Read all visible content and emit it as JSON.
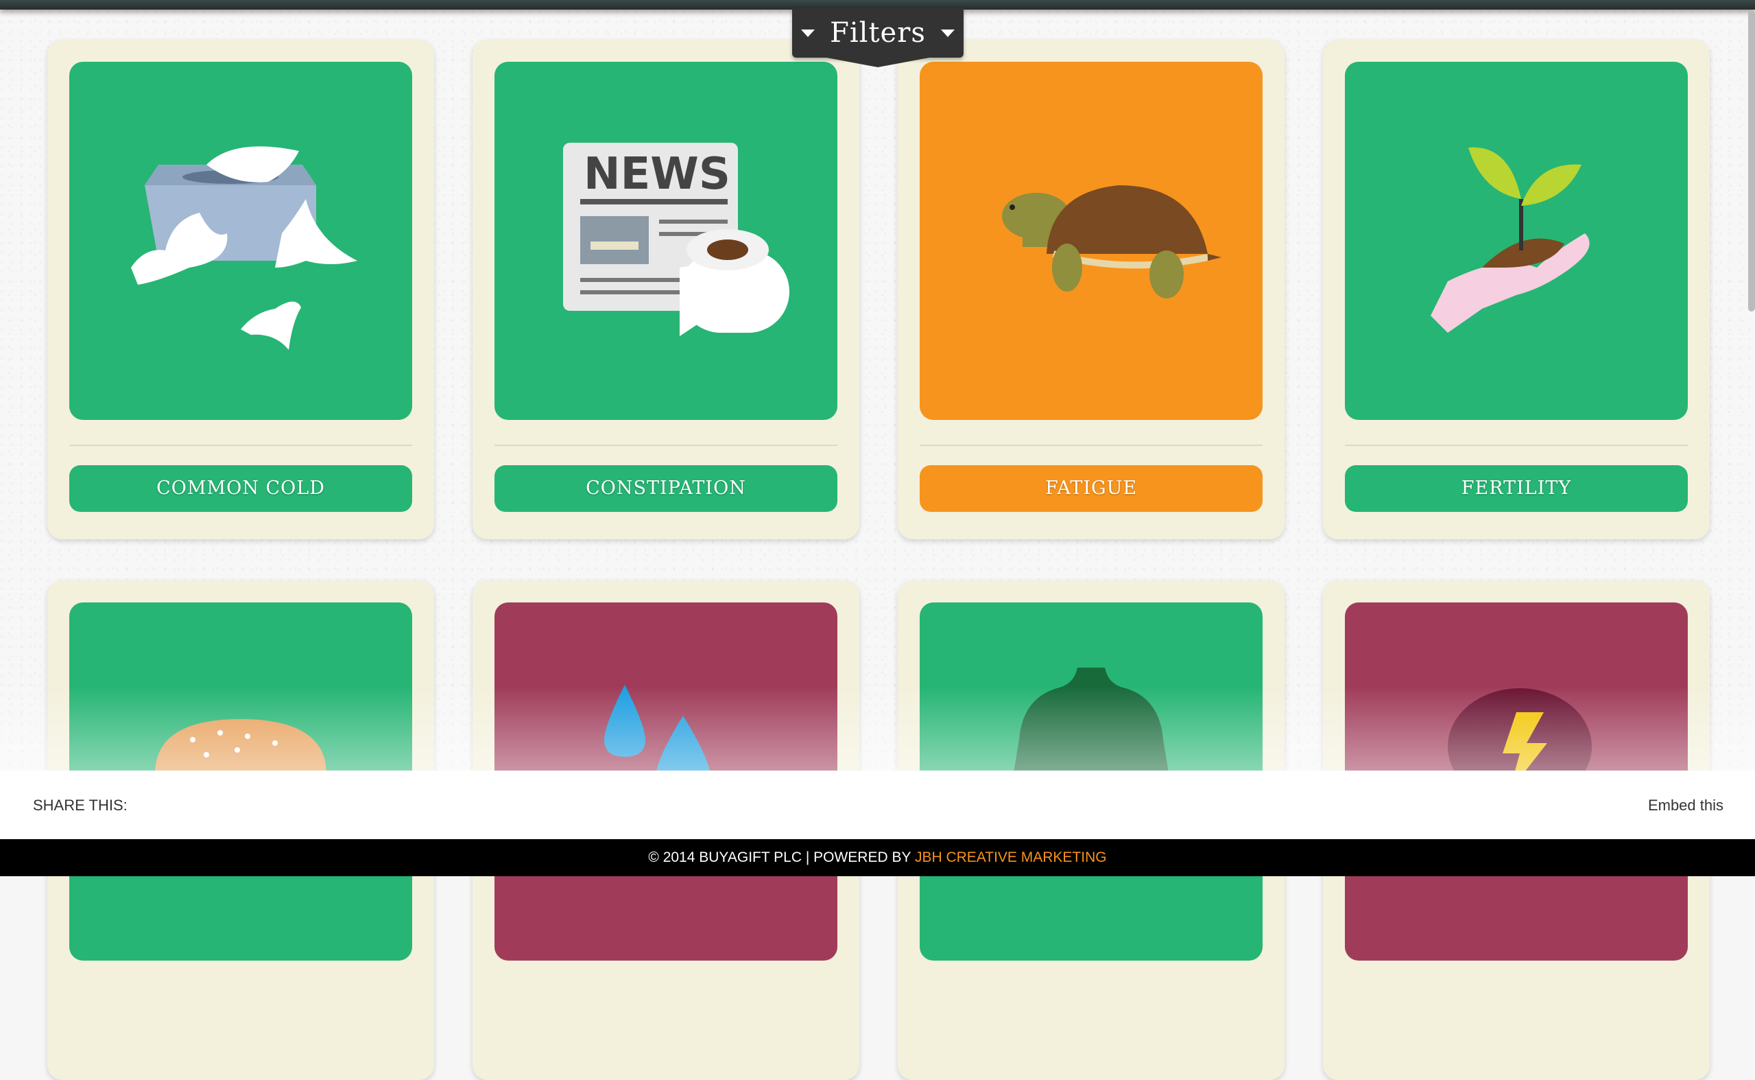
{
  "filters": {
    "label": "Filters"
  },
  "colors": {
    "green": "#26b574",
    "orange": "#f7941d",
    "maroon": "#a03c5a",
    "card": "#f3f1dc"
  },
  "cards_row1": [
    {
      "label": "COMMON COLD",
      "icon": "tissue-box-icon",
      "color": "#26b574"
    },
    {
      "label": "CONSTIPATION",
      "icon": "newspaper-toilet-roll-icon",
      "color": "#26b574"
    },
    {
      "label": "FATIGUE",
      "icon": "tortoise-icon",
      "color": "#f7941d"
    },
    {
      "label": "FERTILITY",
      "icon": "hand-seedling-icon",
      "color": "#26b574"
    }
  ],
  "cards_row2": [
    {
      "icon": "burger-bun-icon",
      "color": "#26b574"
    },
    {
      "icon": "water-drops-icon",
      "color": "#a03c5a"
    },
    {
      "icon": "torso-icon",
      "color": "#26b574"
    },
    {
      "icon": "lightning-bubble-icon",
      "color": "#a03c5a"
    }
  ],
  "share": {
    "label": "SHARE THIS:",
    "embed": "Embed this"
  },
  "footer": {
    "text": "© 2014 BUYAGIFT PLC | POWERED BY ",
    "link": "JBH CREATIVE MARKETING"
  }
}
